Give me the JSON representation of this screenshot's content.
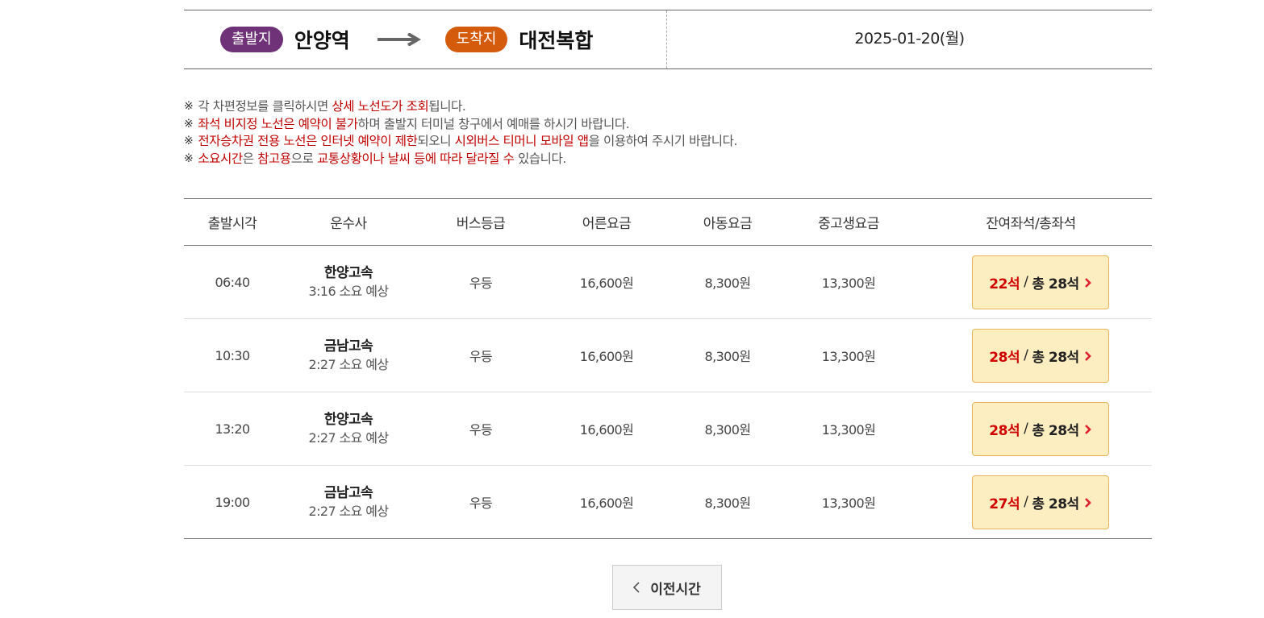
{
  "route": {
    "departure_badge": "출발지",
    "departure_place": "안양역",
    "arrival_badge": "도착지",
    "arrival_place": "대전복합",
    "date": "2025-01-20(월)"
  },
  "notices": [
    [
      {
        "text": "각 차편정보를 클릭하시면 ",
        "hl": false
      },
      {
        "text": "상세 노선도가 조회",
        "hl": true
      },
      {
        "text": "됩니다.",
        "hl": false
      }
    ],
    [
      {
        "text": "좌석 비지정 노선은 예약이 불가",
        "hl": true
      },
      {
        "text": "하며 출발지 터미널 창구에서 예매를 하시기 바랍니다.",
        "hl": false
      }
    ],
    [
      {
        "text": "전자승차권 전용 노선은 인터넷 예약이 제한",
        "hl": true
      },
      {
        "text": "되오니 ",
        "hl": false
      },
      {
        "text": "시외버스 티머니 모바일 앱",
        "hl": true
      },
      {
        "text": "을 이용하여 주시기 바랍니다.",
        "hl": false
      }
    ],
    [
      {
        "text": "소요시간",
        "hl": true
      },
      {
        "text": "은 ",
        "hl": false
      },
      {
        "text": "참고용",
        "hl": true
      },
      {
        "text": "으로 ",
        "hl": false
      },
      {
        "text": "교통상황이나 날씨 등에 따라 달라질 수",
        "hl": true
      },
      {
        "text": " 있습니다.",
        "hl": false
      }
    ]
  ],
  "notice_mark": "※",
  "table": {
    "headers": [
      "출발시각",
      "운수사",
      "버스등급",
      "어른요금",
      "아동요금",
      "중고생요금",
      "잔여좌석/총좌석"
    ],
    "rows": [
      {
        "time": "06:40",
        "company": "한양고속",
        "duration": "3:16 소요 예상",
        "grade": "우등",
        "adult": "16,600원",
        "child": "8,300원",
        "youth": "13,300원",
        "remain": "22석",
        "total": "총 28석"
      },
      {
        "time": "10:30",
        "company": "금남고속",
        "duration": "2:27 소요 예상",
        "grade": "우등",
        "adult": "16,600원",
        "child": "8,300원",
        "youth": "13,300원",
        "remain": "28석",
        "total": "총 28석"
      },
      {
        "time": "13:20",
        "company": "한양고속",
        "duration": "2:27 소요 예상",
        "grade": "우등",
        "adult": "16,600원",
        "child": "8,300원",
        "youth": "13,300원",
        "remain": "28석",
        "total": "총 28석"
      },
      {
        "time": "19:00",
        "company": "금남고속",
        "duration": "2:27 소요 예상",
        "grade": "우등",
        "adult": "16,600원",
        "child": "8,300원",
        "youth": "13,300원",
        "remain": "27석",
        "total": "총 28석"
      }
    ],
    "seat_separator": "/"
  },
  "prev_button": {
    "label": "이전시간"
  },
  "colors": {
    "departure_badge": "#6f3178",
    "arrival_badge": "#d45a0c",
    "highlight": "#c00000",
    "seat_button_bg": "#fdeec2",
    "seat_button_border": "#e8b45a",
    "seat_remain": "#d00000"
  },
  "icons": {
    "route_arrow": "arrow-right-icon",
    "seat_chevron": "chevron-right-icon",
    "prev_chevron": "chevron-left-icon"
  }
}
